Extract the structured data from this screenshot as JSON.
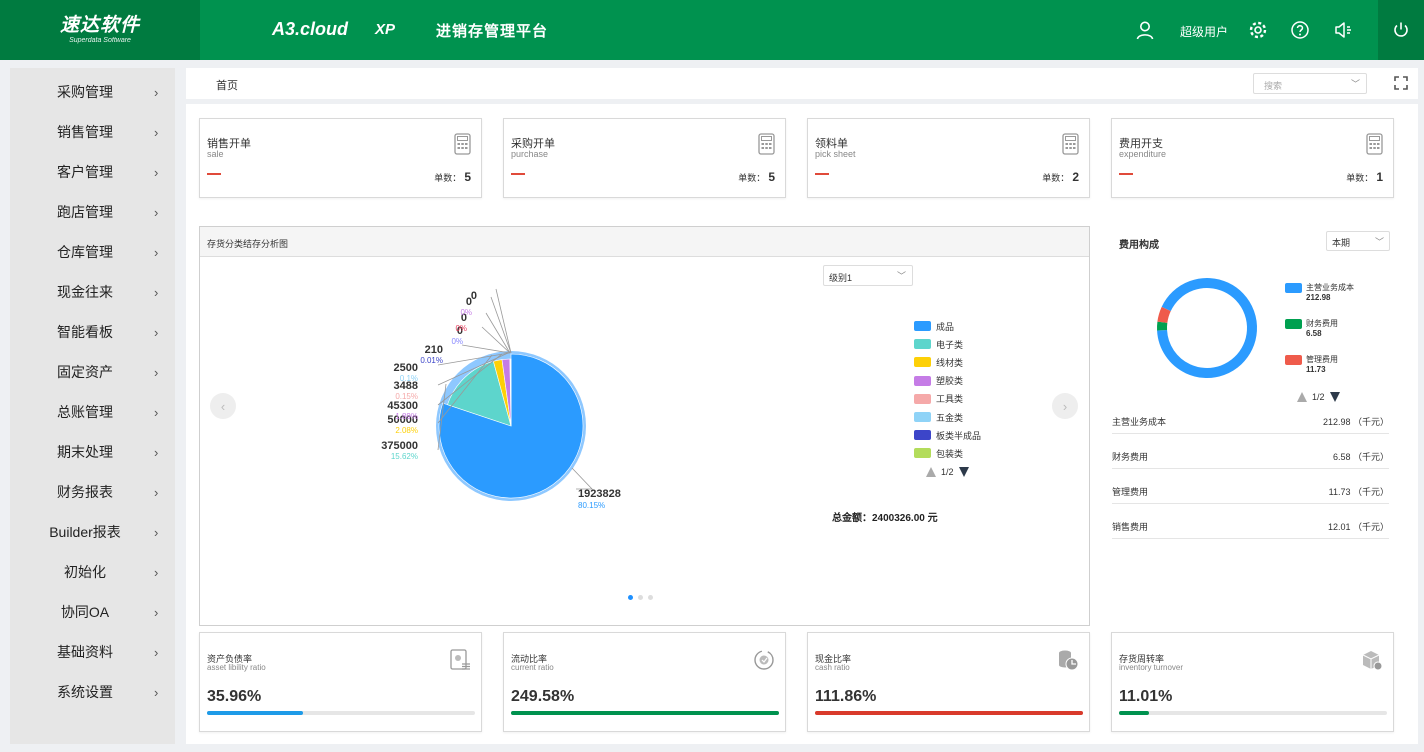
{
  "header": {
    "logo_text": "速达软件",
    "logo_sub": "Superdata Software",
    "brand": "A3.cloud",
    "edition": "XP",
    "platform": "进销存管理平台",
    "user_name": "超级用户"
  },
  "sidebar": {
    "items": [
      {
        "label": "采购管理"
      },
      {
        "label": "销售管理"
      },
      {
        "label": "客户管理"
      },
      {
        "label": "跑店管理"
      },
      {
        "label": "仓库管理"
      },
      {
        "label": "现金往来"
      },
      {
        "label": "智能看板"
      },
      {
        "label": "固定资产"
      },
      {
        "label": "总账管理"
      },
      {
        "label": "期末处理"
      },
      {
        "label": "财务报表"
      },
      {
        "label": "Builder报表"
      },
      {
        "label": "初始化"
      },
      {
        "label": "协同OA"
      },
      {
        "label": "基础资料"
      },
      {
        "label": "系统设置"
      }
    ],
    "chevron": "›"
  },
  "breadcrumb": {
    "home": "首页"
  },
  "search": {
    "placeholder": "搜索"
  },
  "summary_cards": [
    {
      "title": "销售开单",
      "subtitle": "sale",
      "count_label": "单数：",
      "count": "5"
    },
    {
      "title": "采购开单",
      "subtitle": "purchase",
      "count_label": "单数：",
      "count": "5"
    },
    {
      "title": "领料单",
      "subtitle": "pick sheet",
      "count_label": "单数：",
      "count": "2"
    },
    {
      "title": "费用开支",
      "subtitle": "expenditure",
      "count_label": "单数：",
      "count": "1"
    }
  ],
  "inventory_chart": {
    "panel_title": "存货分类结存分析图",
    "level_select": "级别1",
    "total_text": "总金额：2400326.00 元",
    "pager": "1/2",
    "legend": [
      {
        "name": "成品",
        "color": "#2b9bff"
      },
      {
        "name": "电子类",
        "color": "#5dd5cc"
      },
      {
        "name": "线材类",
        "color": "#fdd007"
      },
      {
        "name": "塑胶类",
        "color": "#c57ce6"
      },
      {
        "name": "工具类",
        "color": "#f5a9a9"
      },
      {
        "name": "五金类",
        "color": "#8fd3f7"
      },
      {
        "name": "板类半成品",
        "color": "#3c45c9"
      },
      {
        "name": "包装类",
        "color": "#b3dc5b"
      }
    ],
    "slice_labels": [
      {
        "value": "1923828",
        "pct": "80.15%",
        "color": "#2b9bff"
      },
      {
        "value": "375000",
        "pct": "15.62%",
        "color": "#5dd5cc"
      },
      {
        "value": "50000",
        "pct": "2.08%",
        "color": "#fdd007"
      },
      {
        "value": "45300",
        "pct": "1.89%",
        "color": "#c57ce6"
      },
      {
        "value": "3488",
        "pct": "0.15%",
        "color": "#f5a9a9"
      },
      {
        "value": "2500",
        "pct": "0.1%",
        "color": "#8fd3f7"
      },
      {
        "value": "210",
        "pct": "0.01%",
        "color": "#3c45c9"
      },
      {
        "value": "0",
        "pct": "0%",
        "color": "#8888ff"
      },
      {
        "value": "0",
        "pct": "0%",
        "color": "#e83a5a"
      },
      {
        "value": "0",
        "pct": "0%",
        "color": "#c57ce6"
      },
      {
        "value": "0",
        "pct": "",
        "color": "#333333"
      }
    ]
  },
  "chart_data": {
    "type": "pie",
    "categories": [
      "成品",
      "电子类",
      "线材类",
      "塑胶类",
      "工具类",
      "五金类",
      "板类半成品",
      "包装类"
    ],
    "values": [
      1923828,
      375000,
      50000,
      45300,
      3488,
      2500,
      210,
      0
    ],
    "colors": [
      "#2b9bff",
      "#5dd5cc",
      "#fdd007",
      "#c57ce6",
      "#f5a9a9",
      "#8fd3f7",
      "#3c45c9",
      "#b3dc5b"
    ],
    "title": "存货分类结存分析图"
  },
  "cost": {
    "title": "费用构成",
    "period": "本期",
    "pager": "1/2",
    "donut": [
      {
        "name": "主营业务成本",
        "value": 212.98,
        "display": "212.98",
        "color": "#2b9bff"
      },
      {
        "name": "财务费用",
        "value": 6.58,
        "display": "6.58",
        "color": "#00a050"
      },
      {
        "name": "管理费用",
        "value": 11.73,
        "display": "11.73",
        "color": "#ef5b4b"
      }
    ],
    "rows": [
      {
        "name": "主营业务成本",
        "value": "212.98 （千元）"
      },
      {
        "name": "财务费用",
        "value": "6.58 （千元）"
      },
      {
        "name": "管理费用",
        "value": "11.73 （千元）"
      },
      {
        "name": "销售费用",
        "value": "12.01 （千元）"
      }
    ]
  },
  "ratios": [
    {
      "title": "资产负债率",
      "subtitle": "asset libility ratio",
      "value": "35.96%",
      "fill": 0.3596,
      "color": "#1e9be8"
    },
    {
      "title": "流动比率",
      "subtitle": "current ratio",
      "value": "249.58%",
      "fill": 1.0,
      "color": "#00924f"
    },
    {
      "title": "现金比率",
      "subtitle": "cash ratio",
      "value": "111.86%",
      "fill": 1.0,
      "color": "#d93a2b"
    },
    {
      "title": "存货周转率",
      "subtitle": "inventory turnover",
      "value": "11.01%",
      "fill": 0.1101,
      "color": "#00924f"
    }
  ]
}
